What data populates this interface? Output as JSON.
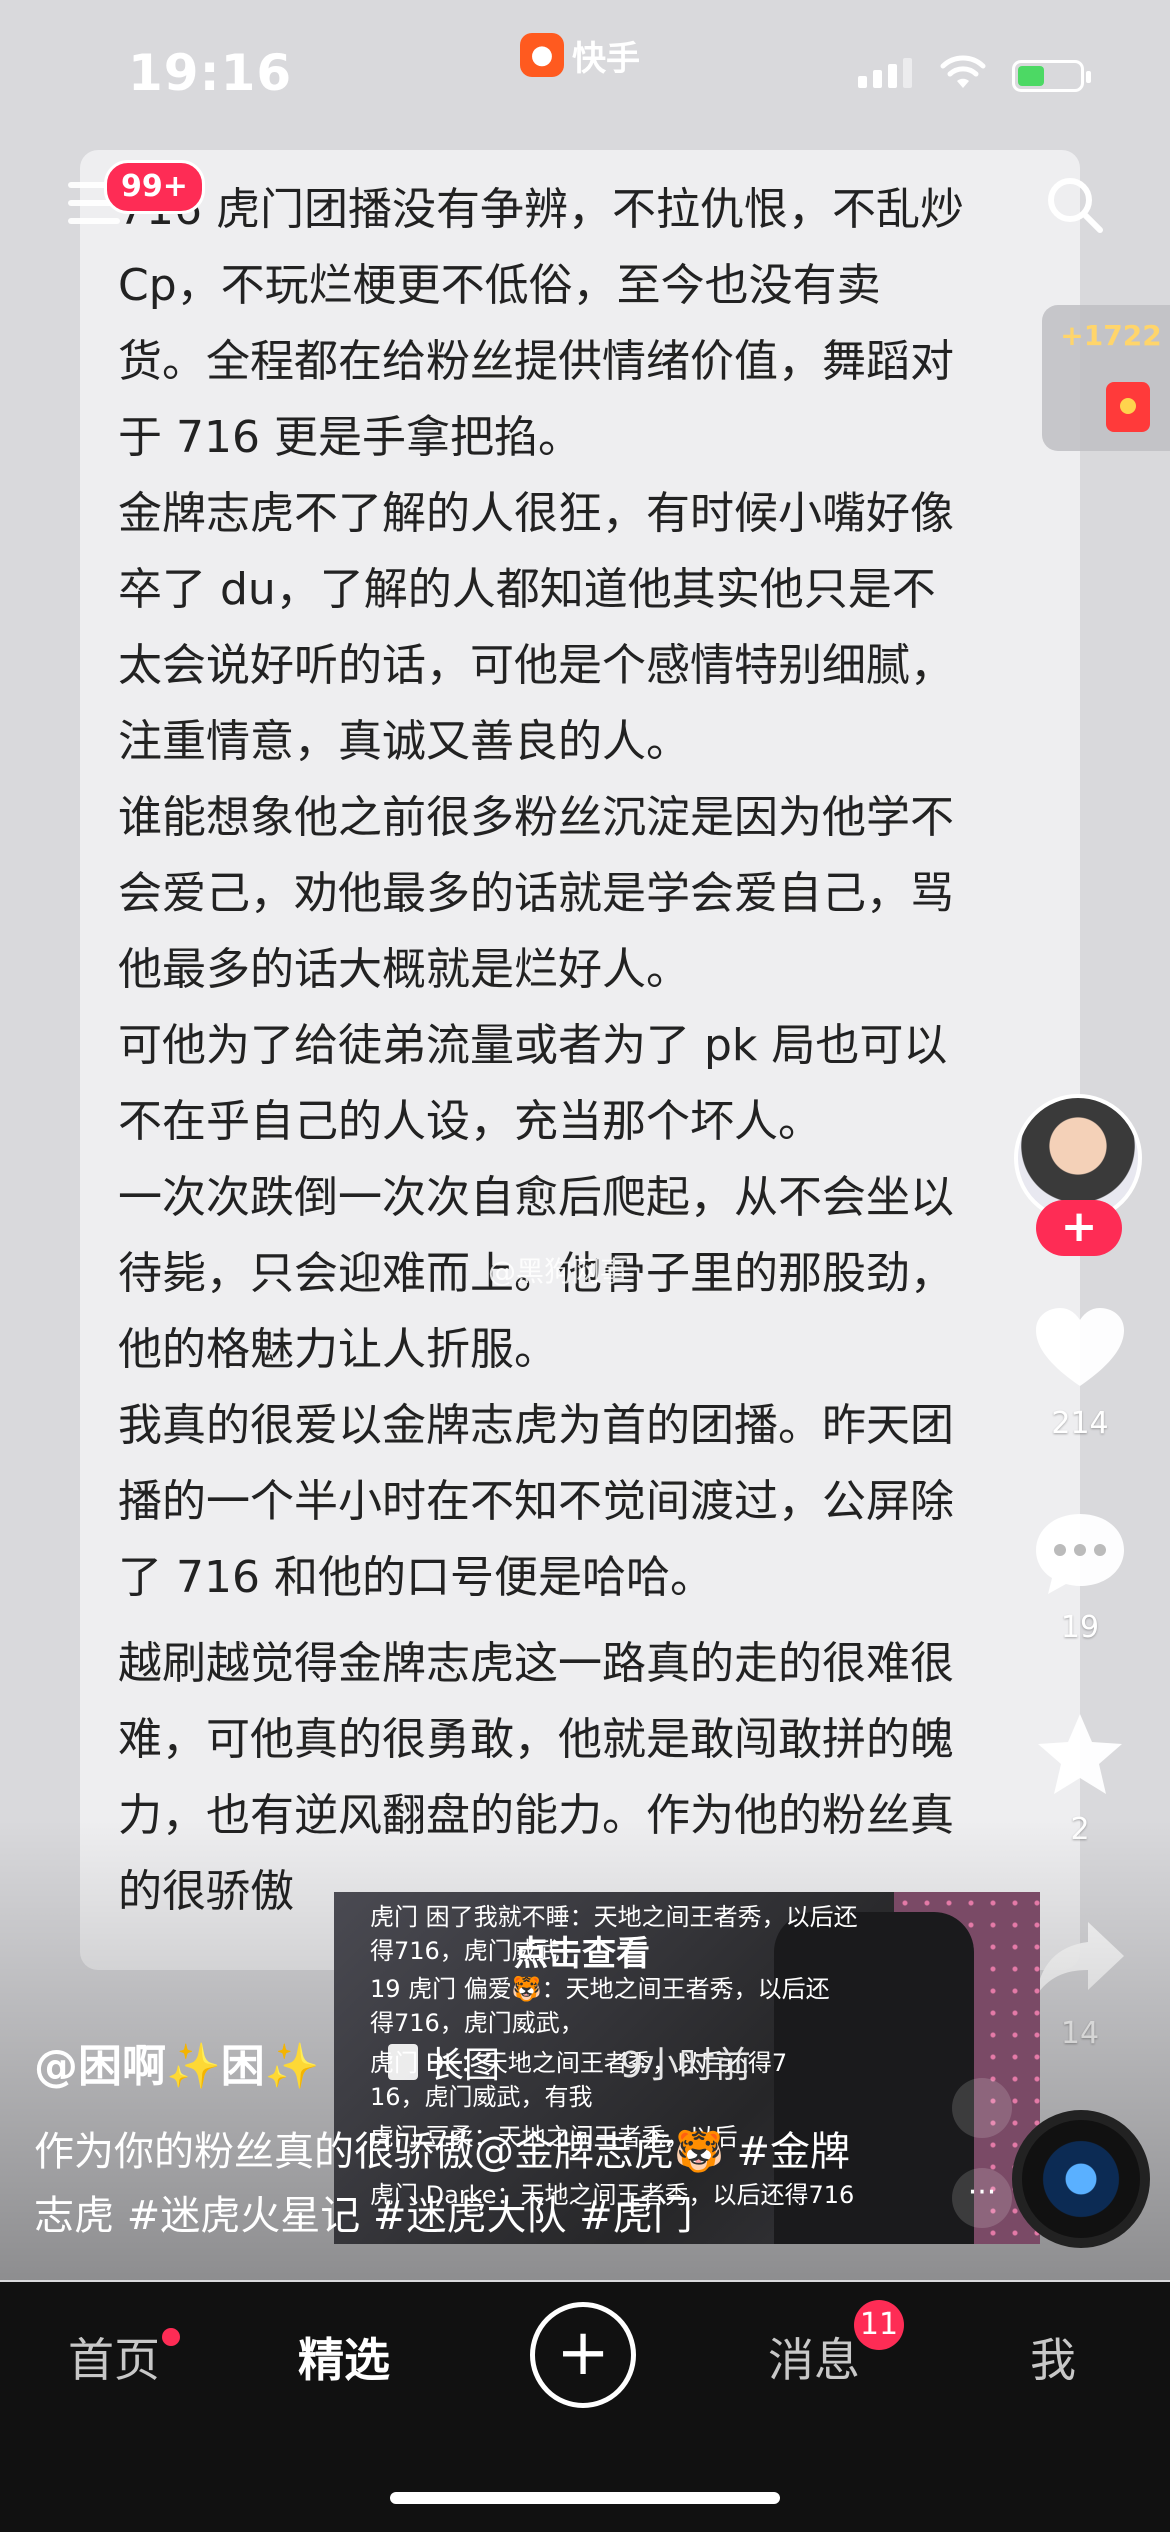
{
  "status_bar": {
    "time": "19:16",
    "app_name": "快手",
    "battery_color": "#4cd964"
  },
  "header": {
    "notification_badge": "99+"
  },
  "article": {
    "paragraphs": [
      "716 虎门团播没有争辨，不拉仇恨，不乱炒\nCp，不玩烂梗更不低俗，至今也没有卖\n货。全程都在给粉丝提供情绪价值，舞蹈对\n于 716 更是手拿把掐。",
      "金牌志虎不了解的人很狂，有时候小嘴好像\n卒了 du，了解的人都知道他其实他只是不\n太会说好听的话，可他是个感情特别细腻，\n注重情意，真诚又善良的人。",
      "谁能想象他之前很多粉丝沉淀是因为他学不\n会爱己，劝他最多的话就是学会爱自己，骂\n他最多的话大概就是烂好人。",
      "可他为了给徒弟流量或者为了 pk 局也可以\n不在乎自己的人设，充当那个坏人。",
      "一次次跌倒一次次自愈后爬起，从不会坐以\n待毙，只会迎难而上。他骨子里的那股劲，\n他的格魅力让人折服。",
      "我真的很爱以金牌志虎为首的团播。昨天团\n播的一个半小时在不知不觉间渡过，公屏除\n了 716 和他的口号便是哈哈。",
      "越刷越觉得金牌志虎这一路真的走的很难很\n难，可他真的很勇敢，他就是敢闯敢拼的魄\n力，也有逆风翻盘的能力。作为他的粉丝真\n的很骄傲"
    ]
  },
  "watermark": "@黑狗网事",
  "sidebar": {
    "reward_count": "+1722",
    "follow_label": "+",
    "like_count": "214",
    "comment_count": "19",
    "favorite_count": "2",
    "share_count": "14"
  },
  "post": {
    "author": "@困啊✨困✨",
    "long_image_label": "长图",
    "time_ago": "9小时前",
    "caption": "作为你的粉丝真的很骄傲@金牌志虎🐯 #金牌志虎 #迷虎火星记 #迷虎大队 #虎门"
  },
  "live_preview": {
    "title": "点击查看",
    "chat": [
      "虎门  困了我就不睡：天地之间王者秀，以后还",
      "得716，虎门威武，",
      "19  虎门  偏爱🐯：天地之间王者秀，以后还",
      "得716，虎门威武，",
      "虎门  DK：天地之间王者秀，以后还得7",
      "16，虎门威武，有我",
      "虎门  豆柔：天地之间王者秀，以后",
      "虎门  Darke：天地之间王者秀，以后还得716"
    ]
  },
  "tabbar": {
    "tabs": [
      "首页",
      "精选",
      "消息",
      "我"
    ],
    "plus_label": "+",
    "message_badge": "11",
    "accent": "#fe2c55"
  }
}
